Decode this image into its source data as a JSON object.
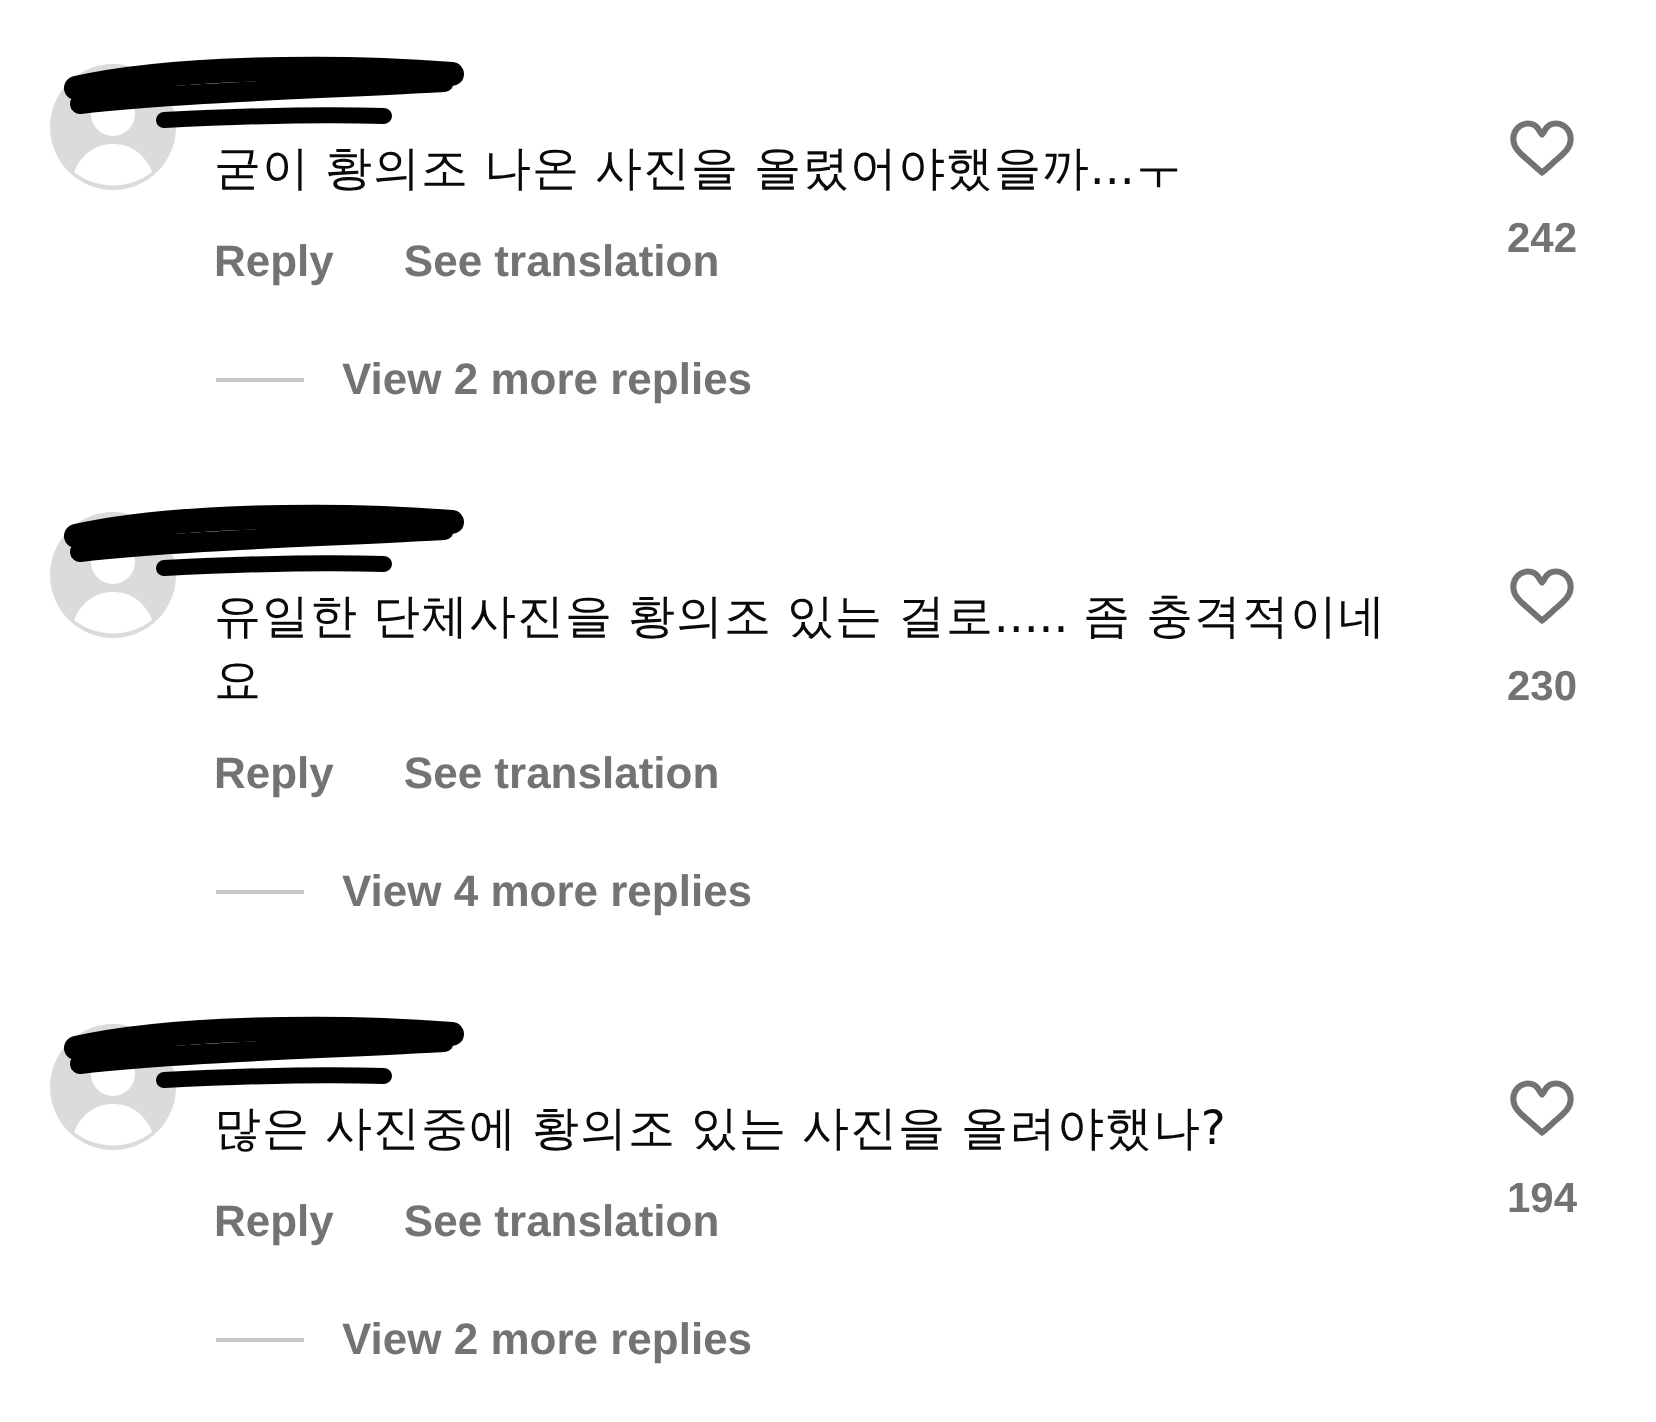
{
  "comments": [
    {
      "author_redacted": true,
      "text": "굳이 황의조 나온 사진을 올렸어야했을까...ㅜ",
      "actions": [
        "Reply",
        "See translation"
      ],
      "liked": false,
      "likes": "242",
      "view_replies": "View 2 more replies"
    },
    {
      "author_redacted": true,
      "text": "유일한 단체사진을 황의조 있는 걸로..... 좀 충격적이네요",
      "actions": [
        "Reply",
        "See translation"
      ],
      "liked": false,
      "likes": "230",
      "view_replies": "View 4 more replies"
    },
    {
      "author_redacted": true,
      "text": "많은 사진중에 황의조 있는 사진을 올려야했나?",
      "actions": [
        "Reply",
        "See translation"
      ],
      "liked": false,
      "likes": "194",
      "view_replies": "View 2 more replies"
    }
  ]
}
